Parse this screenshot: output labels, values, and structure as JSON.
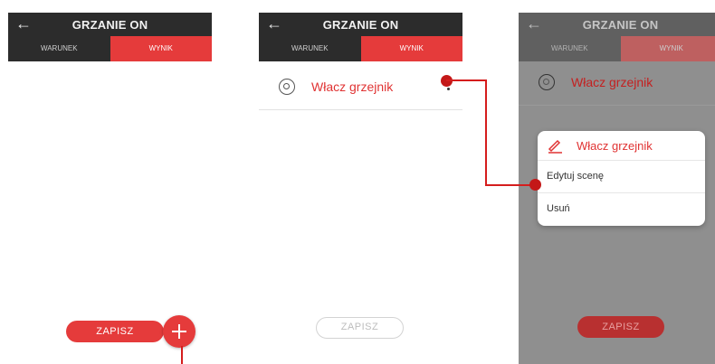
{
  "screens": [
    {
      "title": "GRZANIE ON",
      "tabs": [
        "WARUNEK",
        "WYNIK"
      ],
      "save_label": "ZAPISZ"
    },
    {
      "title": "GRZANIE ON",
      "tabs": [
        "WARUNEK",
        "WYNIK"
      ],
      "item_label": "Włacz grzejnik",
      "save_label": "ZAPISZ"
    },
    {
      "title": "GRZANIE ON",
      "tabs": [
        "WARUNEK",
        "WYNIK"
      ],
      "item_label": "Włacz grzejnik",
      "menu": {
        "title": "Włacz grzejnik",
        "items": [
          "Edytuj scenę",
          "Usuń"
        ]
      },
      "save_label": "ZAPISZ"
    }
  ],
  "colors": {
    "accent": "#e53b3b",
    "header": "#2c2c2c",
    "callout": "#d51d1d"
  }
}
